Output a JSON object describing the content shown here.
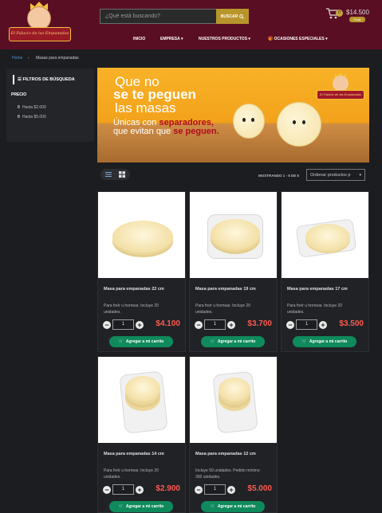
{
  "header": {
    "logo_text": "El Palacio de las Empanadas",
    "search_placeholder": "¿Qué está buscando?",
    "search_button": "BUSCAR",
    "cart_count": "0",
    "cart_total": "$14.500",
    "cart_pill": "Pedir"
  },
  "nav": {
    "items": [
      "INICIO",
      "EMPRESA",
      "NUESTROS PRODUCTOS",
      "OCASIONES ESPECIALES"
    ]
  },
  "breadcrumb": {
    "home": "Home",
    "current": "Masas para empanadas"
  },
  "sidebar": {
    "title": "FILTROS DE BÚSQUEDA",
    "price_label": "PRECIO",
    "price_options": [
      "Hasta $2.000",
      "Hasta $5.000"
    ]
  },
  "banner": {
    "line1": "Que no",
    "line2": "se te peguen",
    "line3": "las masas",
    "sub1_a": "Únicas con ",
    "sub1_b": "separadores,",
    "sub2_a": "que evitan que ",
    "sub2_b": "se peguen.",
    "logo_text": "El Palacio de las Empanadas"
  },
  "toolbar": {
    "showing": "MOSTRANDO 1 - 5 DE 5",
    "sort": "Ordenar productos p"
  },
  "products": [
    {
      "name": "Masa para empanadas 22 cm",
      "desc": "Para freír u hornear. Incluye 20 unidades.",
      "qty": "1",
      "price": "$4.100",
      "button": "Agregar a mi carrito"
    },
    {
      "name": "Masa para empanadas 19 cm",
      "desc": "Para freír u hornear. Incluye 20 unidades.",
      "qty": "1",
      "price": "$3.700",
      "button": "Agregar a mi carrito"
    },
    {
      "name": "Masa para empanadas 17 cm",
      "desc": "Para freír u hornear. Incluye 20 unidades.",
      "qty": "1",
      "price": "$3.500",
      "button": "Agregar a mi carrito"
    },
    {
      "name": "Masa para empanadas 14 cm",
      "desc": "Para freír u hornear. Incluye 20 unidades.",
      "qty": "1",
      "price": "$2.900",
      "button": "Agregar a mi carrito"
    },
    {
      "name": "Masa para empanadas 12 cm",
      "desc": "Incluye 50 unidades. Pedido mínimo 300 unidades.",
      "qty": "1",
      "price": "$5.000",
      "button": "Agregar a mi carrito"
    }
  ],
  "colors": {
    "header_bg": "#5a0e24",
    "gold": "#b8952b",
    "price": "#ff5a4f",
    "add_button": "#0f8a5c"
  }
}
